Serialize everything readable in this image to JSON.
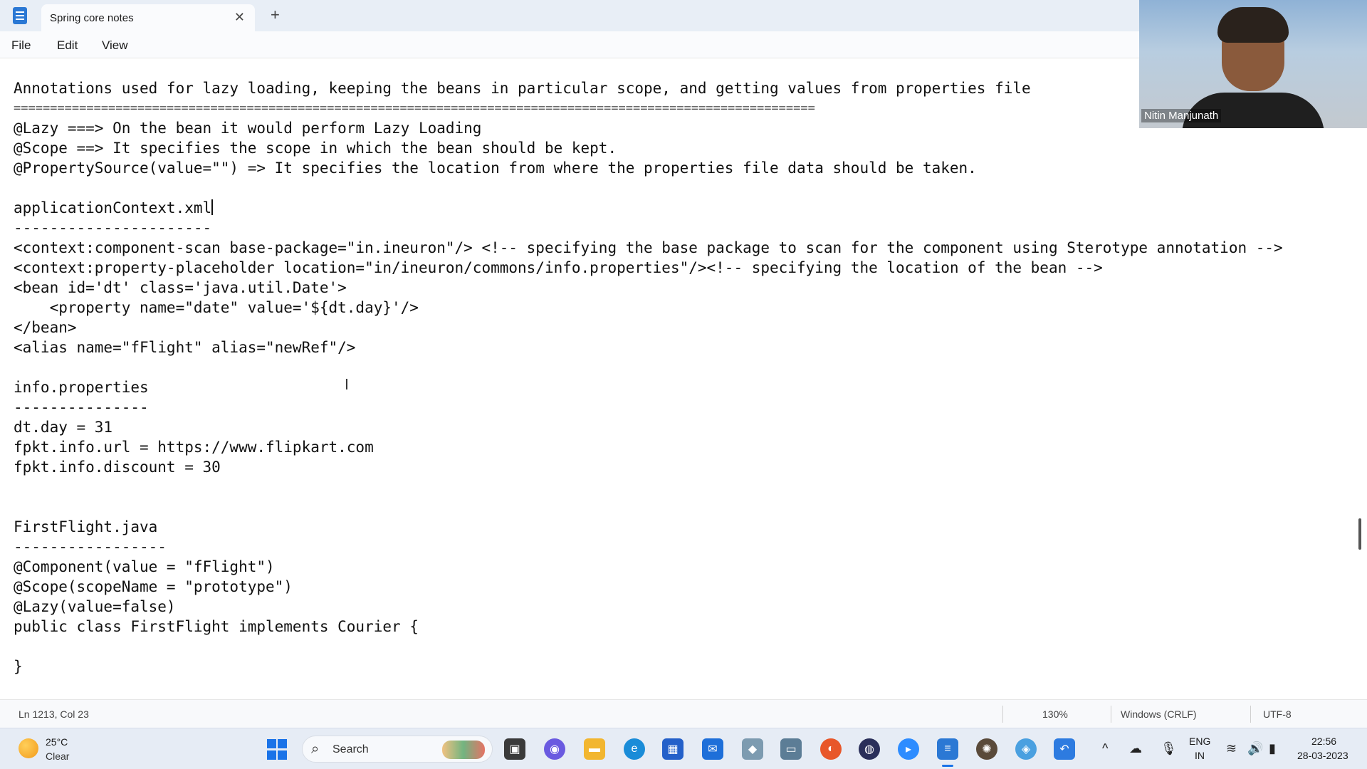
{
  "window": {
    "tab_title": "Spring core notes",
    "tab_close": "✕",
    "new_tab": "+"
  },
  "menu": {
    "items": [
      "File",
      "Edit",
      "View"
    ]
  },
  "editor": {
    "lines": [
      "Annotations used for lazy loading, keeping the beans in particular scope, and getting values from properties file",
      "==============================================================================================================",
      "@Lazy ===> On the bean it would perform Lazy Loading",
      "@Scope ==> It specifies the scope in which the bean should be kept.",
      "@PropertySource(value=\"\") => It specifies the location from where the properties file data should be taken.",
      "",
      "applicationContext.xml",
      "----------------------",
      "<context:component-scan base-package=\"in.ineuron\"/> <!-- specifying the base package to scan for the component using Sterotype annotation -->",
      "<context:property-placeholder location=\"in/ineuron/commons/info.properties\"/><!-- specifying the location of the bean -->",
      "<bean id='dt' class='java.util.Date'>",
      "    <property name=\"date\" value='${dt.day}'/>",
      "</bean>",
      "<alias name=\"fFlight\" alias=\"newRef\"/>",
      "",
      "info.properties",
      "---------------",
      "dt.day = 31",
      "fpkt.info.url = https://www.flipkart.com",
      "fpkt.info.discount = 30",
      "",
      "",
      "FirstFlight.java",
      "-----------------",
      "@Component(value = \"fFlight\")",
      "@Scope(scopeName = \"prototype\")",
      "@Lazy(value=false)",
      "public class FirstFlight implements Courier {",
      "",
      "}"
    ]
  },
  "statusbar": {
    "position": "Ln 1213, Col 23",
    "zoom": "130%",
    "line_ending": "Windows (CRLF)",
    "encoding": "UTF-8"
  },
  "video": {
    "participant_name": "Nitin Manjunath"
  },
  "taskbar": {
    "weather_temp": "25°C",
    "weather_condition": "Clear",
    "search_label": "Search",
    "language_line1": "ENG",
    "language_line2": "IN",
    "time": "22:56",
    "date": "28-03-2023"
  }
}
